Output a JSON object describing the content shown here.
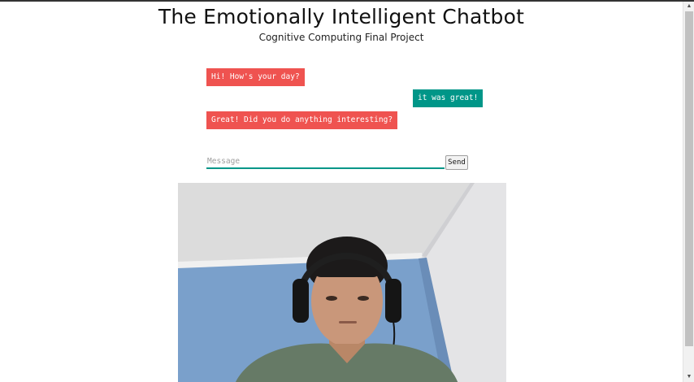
{
  "header": {
    "title": "The Emotionally Intelligent Chatbot",
    "subtitle": "Cognitive Computing Final Project"
  },
  "chat": {
    "messages": [
      {
        "sender": "bot",
        "text": "Hi! How's your day?"
      },
      {
        "sender": "user",
        "text": "it was great!"
      },
      {
        "sender": "bot",
        "text": "Great! Did you do anything interesting?"
      }
    ],
    "input": {
      "placeholder": "Message",
      "value": ""
    },
    "send_label": "Send"
  },
  "webcam": {
    "content": "webcam-feed"
  },
  "scrollbar": {
    "up_icon": "▲",
    "down_icon": "▼"
  },
  "colors": {
    "bot_bubble": "#ef5350",
    "user_bubble": "#009688",
    "input_underline": "#009688"
  }
}
